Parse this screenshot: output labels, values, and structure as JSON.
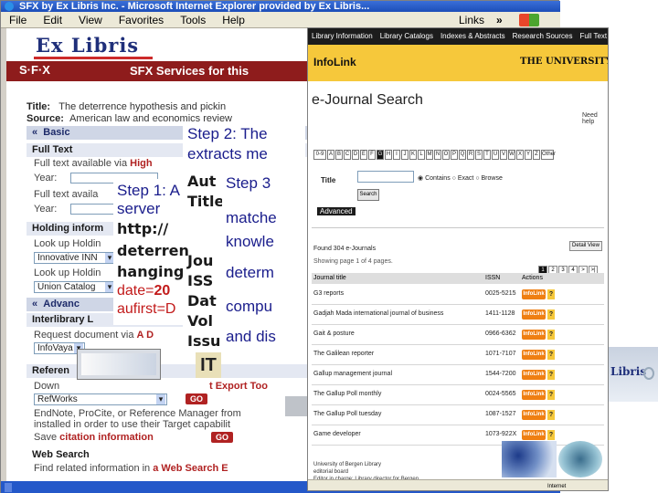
{
  "back_window": {
    "title": "SFX by Ex Libris Inc. - Microsoft Internet Explorer provided by Ex Libris...",
    "menu": [
      "File",
      "Edit",
      "View",
      "Favorites",
      "Tools",
      "Help"
    ],
    "links_label": "Links",
    "chevron": "»",
    "brand": "Ex Libris",
    "sfx_logo": "S·F·X",
    "sfx_banner": "SFX Services for this",
    "title_label": "Title:",
    "title_value": "The deterrence hypothesis and pickin",
    "source_label": "Source:",
    "source_value": "American law and economics review",
    "sections": {
      "basic": "Basic",
      "full_text": "Full Text",
      "full_text_line1": "Full text available via",
      "full_text_line1_link": "High",
      "year_label": "Year:",
      "full_text_line2": "Full text availa",
      "holding": "Holding inform",
      "lookup1": "Look up Holdin",
      "select1": "Innovative INN",
      "lookup2": "Look up Holdin",
      "select2": "Union Catalog",
      "advanced": "Advanc",
      "interlibrary": "Interlibrary L",
      "request": "Request document via",
      "request_link": "A D",
      "select3": "InfoVaya",
      "reference": "Referen",
      "export_link": "t Export Too",
      "download": "Down",
      "refworks": "RefWorks",
      "go": "GO",
      "endnote_line1": "EndNote, ProCite, or Reference Manager from",
      "endnote_line2": "installed in order to use their Target capabilit",
      "save_prefix": "Save",
      "save_link": "citation information",
      "web_search": "Web Search",
      "web_find": "Find related information in",
      "web_link": "a Web Search E"
    }
  },
  "right_window": {
    "nav": [
      "Library Information",
      "Library Catalogs",
      "Indexes & Abstracts",
      "Research Sources",
      "Full Text"
    ],
    "infolink": "InfoLink",
    "university": "THE UNIVERSITY OF IOWA",
    "page_title": "e-Journal Search",
    "help": "Need help",
    "alphabet": [
      "0-9",
      "A",
      "B",
      "C",
      "D",
      "E",
      "F",
      "G",
      "H",
      "I",
      "J",
      "K",
      "L",
      "M",
      "N",
      "O",
      "P",
      "Q",
      "R",
      "S",
      "T",
      "U",
      "V",
      "W",
      "X",
      "Y",
      "Z",
      "Other"
    ],
    "selected_letter": "G",
    "title_field_label": "Title",
    "radio_options": [
      "Contains",
      "Exact",
      "Browse"
    ],
    "search_button": "Search",
    "advanced": "Advanced",
    "found_text": "Found 304 e-Journals",
    "showing_text": "Showing page 1 of 4 pages.",
    "detail_view": "Detail View",
    "pages": [
      "1",
      "2",
      "3",
      "4",
      ">",
      ">|"
    ],
    "columns": [
      "Journal title",
      "ISSN",
      "Actions"
    ],
    "results": [
      {
        "title": "G3 reports",
        "issn": "0025-5215"
      },
      {
        "title": "Gadjah Mada international journal of business",
        "issn": "1411-1128"
      },
      {
        "title": "Gait & posture",
        "issn": "0966-6362"
      },
      {
        "title": "The Galilean reporter",
        "issn": "1071-7107"
      },
      {
        "title": "Gallup management journal",
        "issn": "1544-7200"
      },
      {
        "title": "The Gallup Poll monthly",
        "issn": "0024-5565"
      },
      {
        "title": "The Gallup Poll tuesday",
        "issn": "1087-1527"
      },
      {
        "title": "Game developer",
        "issn": "1073-922X"
      }
    ],
    "infolink_button": "InfoLink",
    "help_glyph": "?",
    "footer_lines": [
      "University of Bergen Library",
      "editorial board",
      "Editor in charge: Library director for Bergen"
    ],
    "status_zone": "Internet"
  },
  "third_window": {
    "brand_fragment": "Libris"
  },
  "callouts": {
    "step2_line1": "Step 2: The",
    "step2_line2": "extracts me",
    "step3": "Step 3",
    "step3_line2": "matche",
    "step3_line3": "knowle",
    "step3_line4": "determ",
    "step3_line5": "compu",
    "step3_line6": "and dis",
    "step1_line1": "Step 1: A",
    "step1_line2": "server",
    "bold_auth": "Aut",
    "bold_title": "Title",
    "bold_journal": "Jou",
    "bold_issn": "ISS",
    "bold_date": "Dat",
    "bold_volume": "Vol",
    "bold_issue": "Issu",
    "url_prefix": "http://",
    "url_line2": "deterren",
    "url_line3": "hanging",
    "url_date_key": "date=",
    "url_date_val": "20",
    "url_aufirst": "aufirst=D",
    "thumb_label": "IT"
  }
}
